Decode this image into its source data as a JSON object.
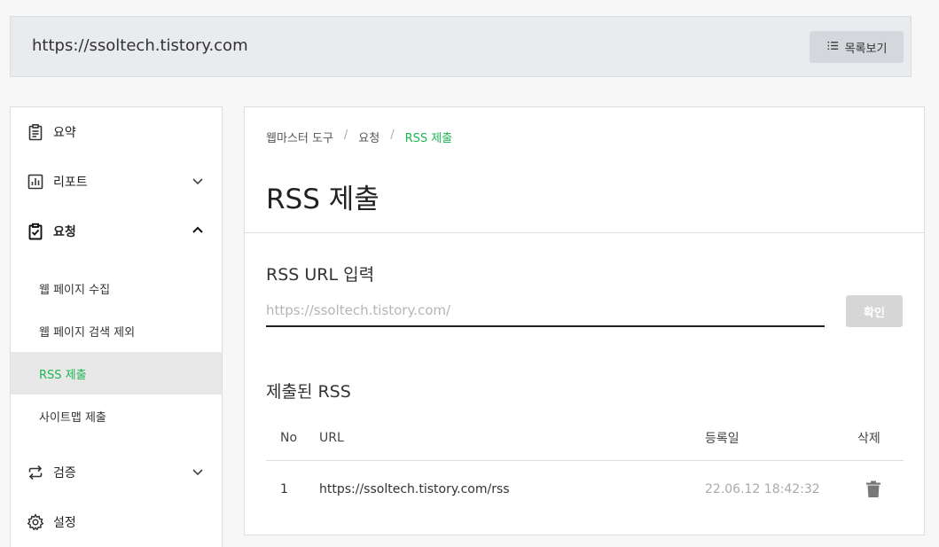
{
  "header": {
    "site_url": "https://ssoltech.tistory.com",
    "list_button_label": "목록보기",
    "list_icon": "list-icon"
  },
  "sidebar": {
    "items": [
      {
        "label": "요약",
        "icon": "clipboard-icon"
      },
      {
        "label": "리포트",
        "icon": "bar-chart-icon"
      },
      {
        "label": "요청",
        "icon": "clipboard-check-icon"
      },
      {
        "label": "검증",
        "icon": "repeat-icon"
      },
      {
        "label": "설정",
        "icon": "gear-icon"
      }
    ],
    "sub_items": [
      {
        "label": "웹 페이지 수집"
      },
      {
        "label": "웹 페이지 검색 제외"
      },
      {
        "label": "RSS 제출"
      },
      {
        "label": "사이트맵 제출"
      }
    ]
  },
  "breadcrumb": {
    "items": [
      "웹마스터 도구",
      "요청",
      "RSS 제출"
    ],
    "separator": "/"
  },
  "page": {
    "title": "RSS 제출"
  },
  "rss_form": {
    "label": "RSS URL 입력",
    "placeholder": "https://ssoltech.tistory.com/",
    "value": "",
    "confirm_label": "확인"
  },
  "submitted": {
    "label": "제출된 RSS",
    "columns": [
      "No",
      "URL",
      "등록일",
      "삭제"
    ],
    "rows": [
      {
        "no": "1",
        "url": "https://ssoltech.tistory.com/rss",
        "date": "22.06.12 18:42:32"
      }
    ]
  },
  "colors": {
    "accent": "#1db653",
    "active_bg": "#e8e8e8",
    "disabled_button": "#d6d6d6"
  }
}
